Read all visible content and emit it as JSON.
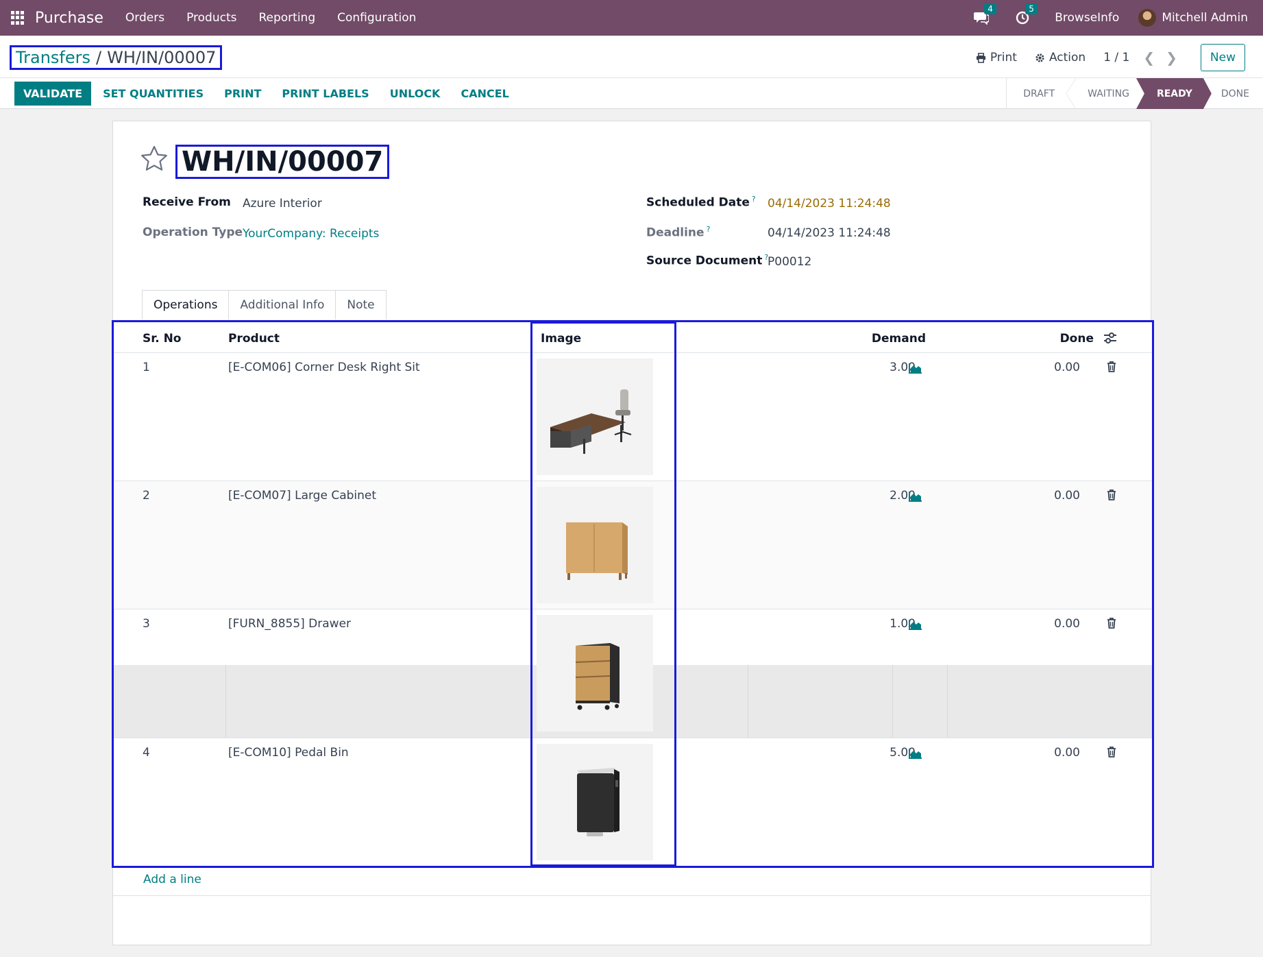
{
  "navbar": {
    "app_name": "Purchase",
    "menu": [
      "Orders",
      "Products",
      "Reporting",
      "Configuration"
    ],
    "messages_count": "4",
    "activities_count": "5",
    "company": "BrowseInfo",
    "user": "Mitchell Admin",
    "bg_color": "#714b67"
  },
  "control_panel": {
    "breadcrumb_parent": "Transfers",
    "breadcrumb_sep": "/",
    "breadcrumb_current": "WH/IN/00007",
    "print_label": "Print",
    "action_label": "Action",
    "pager": "1 / 1",
    "new_label": "New",
    "buttons": {
      "validate": "VALIDATE",
      "set_quantities": "SET QUANTITIES",
      "print": "PRINT",
      "print_labels": "PRINT LABELS",
      "unlock": "UNLOCK",
      "cancel": "CANCEL"
    },
    "stages": [
      "DRAFT",
      "WAITING",
      "READY",
      "DONE"
    ],
    "active_stage": "READY"
  },
  "form": {
    "title": "WH/IN/00007",
    "receive_from_label": "Receive From",
    "receive_from": "Azure Interior",
    "operation_type_label": "Operation Type",
    "operation_type": "YourCompany: Receipts",
    "scheduled_date_label": "Scheduled Date",
    "scheduled_date": "04/14/2023 11:24:48",
    "deadline_label": "Deadline",
    "deadline": "04/14/2023 11:24:48",
    "source_document_label": "Source Document",
    "source_document": "P00012",
    "help_mark": "?",
    "tabs": [
      "Operations",
      "Additional Info",
      "Note"
    ],
    "table": {
      "headers": {
        "sr_no": "Sr. No",
        "product": "Product",
        "image": "Image",
        "demand": "Demand",
        "done": "Done"
      },
      "rows": [
        {
          "sr": "1",
          "product": "[E-COM06] Corner Desk Right Sit",
          "image": "corner-desk",
          "demand": "3.00",
          "done": "0.00"
        },
        {
          "sr": "2",
          "product": "[E-COM07] Large Cabinet",
          "image": "large-cabinet",
          "demand": "2.00",
          "done": "0.00"
        },
        {
          "sr": "3",
          "product": "[FURN_8855] Drawer",
          "image": "drawer",
          "demand": "1.00",
          "done": "0.00"
        },
        {
          "sr": "4",
          "product": "[E-COM10] Pedal Bin",
          "image": "pedal-bin",
          "demand": "5.00",
          "done": "0.00"
        }
      ]
    },
    "add_line": "Add a line"
  },
  "colors": {
    "accent": "#017e84",
    "highlight_box": "#1a1adb",
    "warning_date": "#9a6b06"
  }
}
